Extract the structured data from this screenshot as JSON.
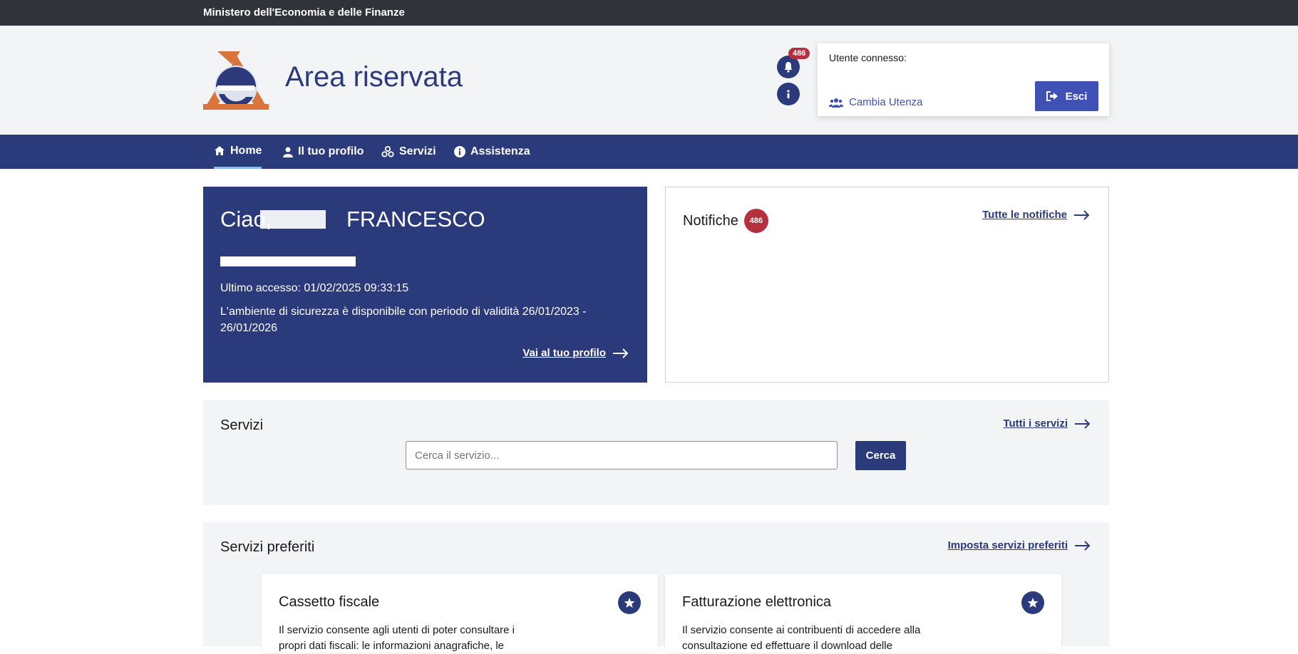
{
  "topbar": {
    "ministry": "Ministero dell'Economia e delle Finanze"
  },
  "header": {
    "title": "Area riservata",
    "notification_count": "486",
    "user_label": "Utente connesso:",
    "switch_user": "Cambia Utenza",
    "logout": "Esci"
  },
  "nav": {
    "items": [
      {
        "label": "Home",
        "icon": "home-icon",
        "active": true
      },
      {
        "label": "Il tuo profilo",
        "icon": "user-icon"
      },
      {
        "label": "Servizi",
        "icon": "services-icon"
      },
      {
        "label": "Assistenza",
        "icon": "info-icon"
      }
    ]
  },
  "welcome": {
    "greeting_prefix": "Ciao,",
    "greeting_name": "FRANCESCO",
    "last_access": "Ultimo accesso: 01/02/2025 09:33:15",
    "security": "L'ambiente di sicurezza è disponibile con periodo di validità 26/01/2023 - 26/01/2026",
    "profile_link": "Vai al tuo profilo"
  },
  "notifications": {
    "title": "Notifiche",
    "count": "486",
    "all_link": "Tutte le notifiche"
  },
  "services": {
    "title": "Servizi",
    "all_link": "Tutti i servizi",
    "search_placeholder": "Cerca il servizio...",
    "search_button": "Cerca"
  },
  "favorites": {
    "title": "Servizi preferiti",
    "set_link": "Imposta servizi preferiti",
    "cards": [
      {
        "title": "Cassetto fiscale",
        "desc": "Il servizio consente agli utenti di poter consultare i propri dati fiscali: le informazioni anagrafiche, le"
      },
      {
        "title": "Fatturazione elettronica",
        "desc": "Il servizio consente ai contribuenti di accedere alla consultazione ed effettuare il download delle"
      }
    ]
  },
  "colors": {
    "primary": "#2b3a7a",
    "accent": "#3f51b5",
    "badge": "#b5303f",
    "topbar": "#30343a"
  }
}
